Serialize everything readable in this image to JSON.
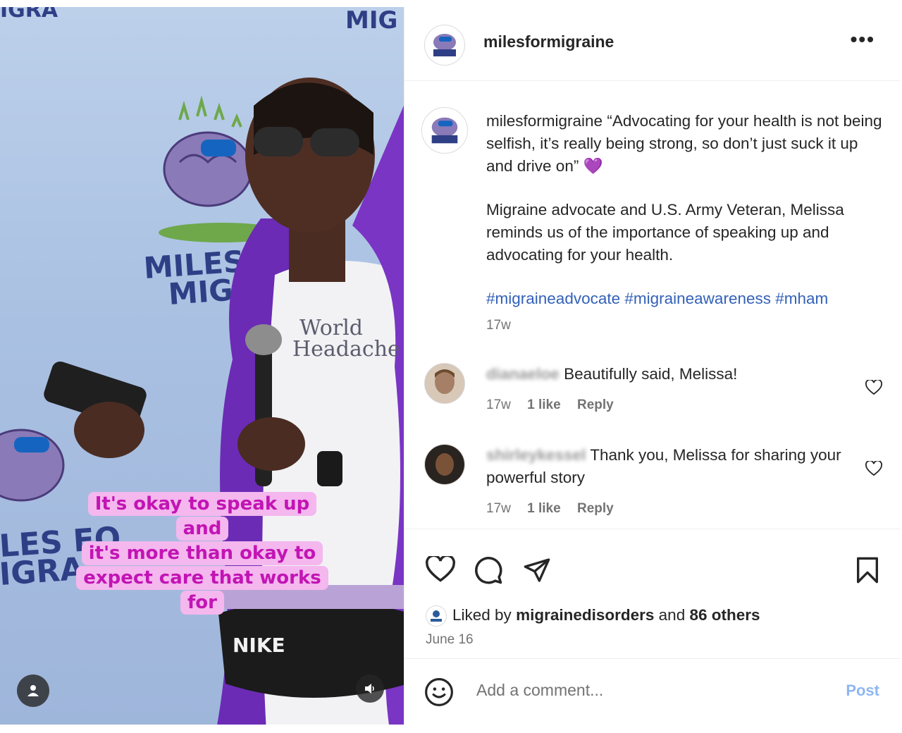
{
  "media": {
    "background_logo_text_1": "MILES FOR",
    "background_logo_text_2": "MIGRAINE",
    "shirt_text": "World Headache",
    "caption_lines": [
      "It's okay to speak up and",
      "it's more than okay to",
      "expect care that works",
      "for"
    ],
    "caption_color": "#c214b4",
    "caption_bg": "#f4b7ee",
    "buttons": {
      "tagged_users_icon": "person-icon",
      "audio_icon": "speaker-icon"
    }
  },
  "header": {
    "username": "milesformigraine",
    "more_label": "•••"
  },
  "post": {
    "author": "milesformigraine",
    "quote": "“Advocating for your health is not being selfish, it’s really being strong, so don’t just suck it up and drive on”",
    "emoji": "💜",
    "body": "Migraine advocate and U.S. Army Veteran, Melissa reminds us of the importance of speaking up and advocating for your health.",
    "hashtags": "#migraineadvocate #migraineawareness #mham",
    "time": "17w"
  },
  "comments": [
    {
      "username": "dianaeloe",
      "text": "Beautifully said, Melissa!",
      "time": "17w",
      "likes": "1 like",
      "reply": "Reply"
    },
    {
      "username": "shirleykessel",
      "text": "Thank you, Melissa for sharing your powerful story",
      "time": "17w",
      "likes": "1 like",
      "reply": "Reply"
    }
  ],
  "engagement": {
    "liked_by_prefix": "Liked by",
    "liked_by_user": "migrainedisorders",
    "and": "and",
    "others": "86 others",
    "date": "June 16"
  },
  "add_comment": {
    "placeholder": "Add a comment...",
    "post_label": "Post"
  },
  "colors": {
    "hashtag": "#3361b8",
    "post_button": "#8fb7f2",
    "secondary_text": "#737373"
  }
}
